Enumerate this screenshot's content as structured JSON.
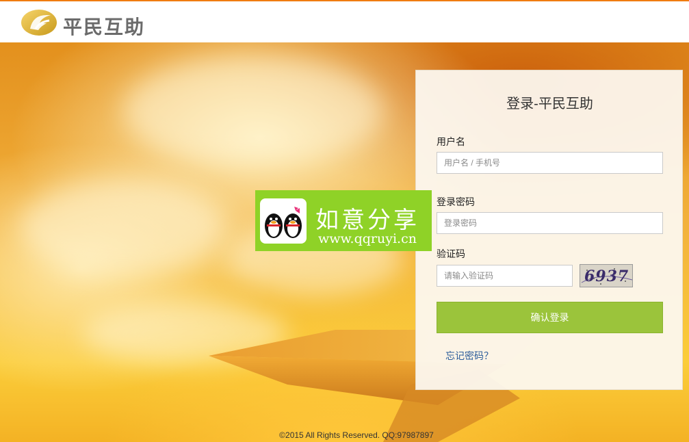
{
  "header": {
    "brand_name": "平民互助",
    "logo_icon": "coin-logo-icon"
  },
  "login": {
    "title": "登录-平民互助",
    "username_label": "用户名",
    "username_placeholder": "用户名 / 手机号",
    "password_label": "登录密码",
    "password_placeholder": "登录密码",
    "captcha_label": "验证码",
    "captcha_placeholder": "请输入验证码",
    "captcha_text": "6937",
    "submit_label": "确认登录",
    "forgot_label": "忘记密码？"
  },
  "watermark": {
    "title": "如意分享",
    "url": "www.qqruyi.cn",
    "icon": "penguin-couple-icon"
  },
  "footer": {
    "copyright": "©2015 All Rights Reserved. QQ:97987897"
  },
  "colors": {
    "accent_orange": "#f07c10",
    "button_green": "#9bc43b",
    "link_blue": "#2a5c9a",
    "watermark_green": "#8fd227"
  }
}
